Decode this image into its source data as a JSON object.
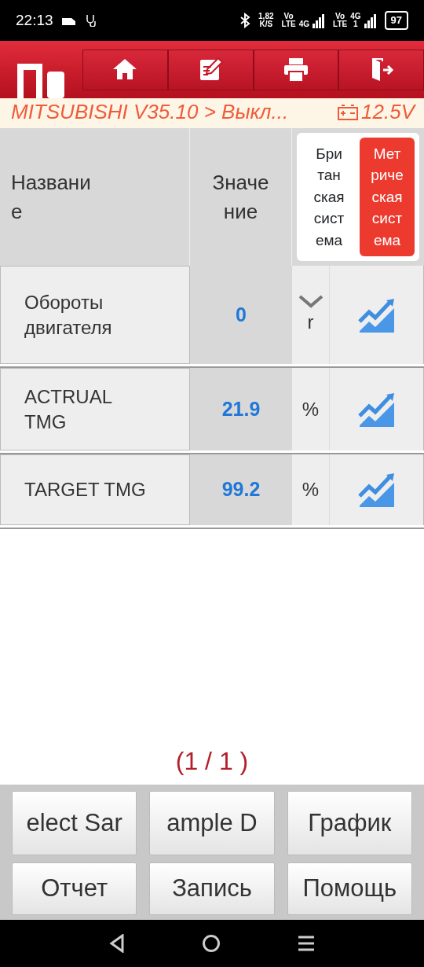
{
  "status_bar": {
    "time": "22:13",
    "speed": "1,82",
    "speed_unit": "K/S",
    "sim1": [
      "Vo",
      "LTE",
      "4G"
    ],
    "sim2": [
      "Vo",
      "LTE",
      "4G",
      "1"
    ],
    "battery": "97"
  },
  "breadcrumb": {
    "text": "MITSUBISHI V35.10 > Выкл...",
    "voltage": "12.5V"
  },
  "table": {
    "columns": [
      "Названи е",
      "Значе ние"
    ],
    "unit_toggle": [
      {
        "label": "Бри тан ская сист ема",
        "selected": false
      },
      {
        "label": "Мет риче ская сист ема",
        "selected": true
      }
    ],
    "rows": [
      {
        "name": "Обороты двигателя",
        "value": "0",
        "unit": "r",
        "dropdown": true
      },
      {
        "name": "ACTRUAL TMG",
        "value": "21.9",
        "unit": "%",
        "dropdown": false
      },
      {
        "name": "TARGET TMG",
        "value": "99.2",
        "unit": "%",
        "dropdown": false
      }
    ]
  },
  "pager": "(1 / 1 )",
  "buttons": [
    "elect Sar",
    "ample D",
    "График",
    "Отчет",
    "Запись",
    "Помощь"
  ]
}
